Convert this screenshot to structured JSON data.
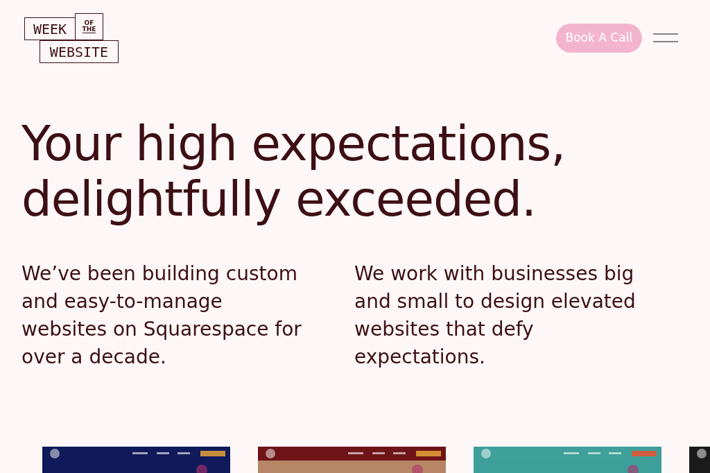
{
  "logo": {
    "word_1": "WEEK",
    "word_2": "OF",
    "word_3": "THE",
    "word_4": "WEBSITE"
  },
  "header": {
    "cta_button": "Book A Call"
  },
  "headline": {
    "lines": [
      "Your high expectations,",
      "delightfully exceeded."
    ]
  },
  "intro": [
    {
      "lines": [
        "We’ve been building custom",
        "and easy-to-manage",
        "websites on Squarespace for",
        "over a decade."
      ]
    },
    {
      "lines": [
        "We work with businesses big",
        "and small to design elevated",
        "websites that defy",
        "expectations."
      ]
    }
  ]
}
